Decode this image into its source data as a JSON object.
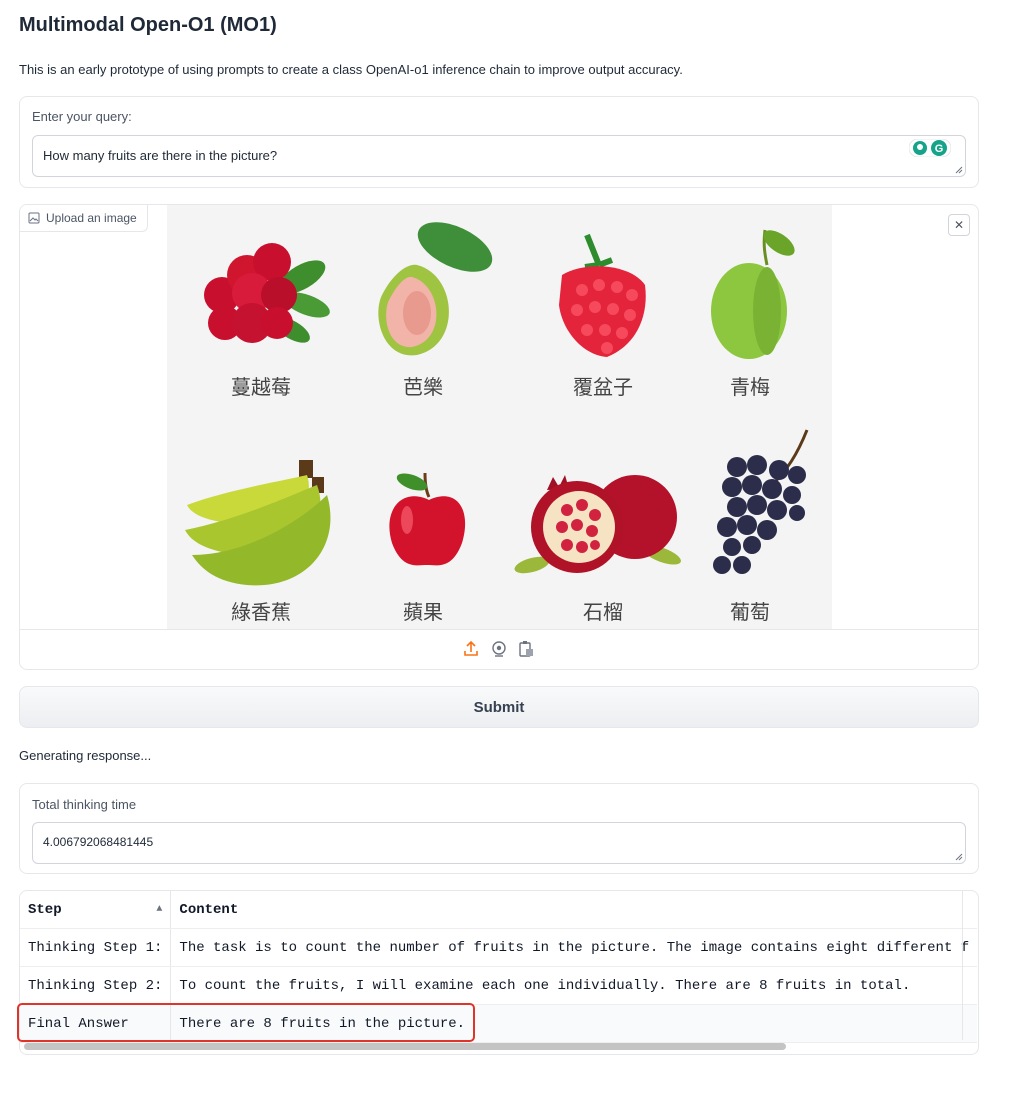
{
  "header": {
    "title": "Multimodal Open-O1 (MO1)",
    "description": "This is an early prototype of using prompts to create a class OpenAI-o1 inference chain to improve output accuracy."
  },
  "query": {
    "label": "Enter your query:",
    "value": "How many fruits are there in the picture?"
  },
  "image_upload": {
    "tag_label": "Upload an image",
    "close_glyph": "✕",
    "fruits": [
      "蔓越莓",
      "芭樂",
      "覆盆子",
      "青梅",
      "綠香蕉",
      "蘋果",
      "石榴",
      "葡萄"
    ]
  },
  "submit_label": "Submit",
  "status_text": "Generating response...",
  "thinking": {
    "label": "Total thinking time",
    "value": "4.006792068481445"
  },
  "table": {
    "headers": [
      "Step",
      "Content"
    ],
    "sort_glyph": "▲",
    "rows": [
      {
        "step": "Thinking Step 1:",
        "content": "The task is to count the number of fruits in the picture. The image contains eight different f"
      },
      {
        "step": "Thinking Step 2:",
        "content": "To count the fruits, I will examine each one individually. There are 8 fruits in total."
      },
      {
        "step": "Final Answer",
        "content": "There are 8 fruits in the picture."
      }
    ]
  },
  "colors": {
    "accent_orange": "#f97316",
    "highlight_red": "#e0342a"
  }
}
